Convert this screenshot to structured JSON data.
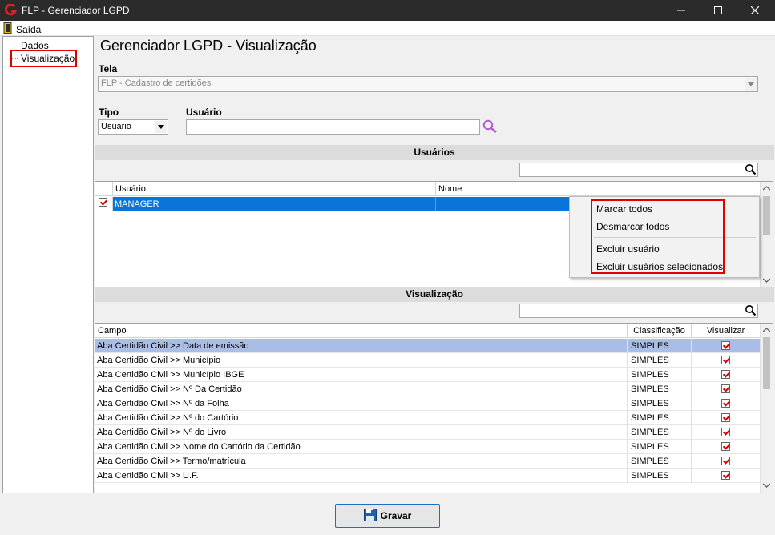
{
  "window": {
    "title": "FLP - Gerenciador LGPD"
  },
  "menu": {
    "exit_label": "Saída"
  },
  "tree": {
    "items": [
      {
        "label": "Dados"
      },
      {
        "label": "Visualização"
      }
    ]
  },
  "page": {
    "title": "Gerenciador LGPD - Visualização"
  },
  "form": {
    "tela_label": "Tela",
    "tela_value": "FLP - Cadastro de certidões",
    "tipo_label": "Tipo",
    "tipo_value": "Usuário",
    "usuario_label": "Usuário",
    "usuario_value": ""
  },
  "users_section": {
    "header": "Usuários",
    "search_value": "",
    "columns": [
      "Usuário",
      "Nome"
    ],
    "rows": [
      {
        "checked": true,
        "usuario": "MANAGER",
        "nome": ""
      }
    ]
  },
  "context_menu": {
    "items": [
      "Marcar todos",
      "Desmarcar todos",
      "Excluir usuário",
      "Excluir usuários selecionados"
    ]
  },
  "view_section": {
    "header": "Visualização",
    "search_value": "",
    "columns": [
      "Campo",
      "Classificação",
      "Visualizar"
    ],
    "rows": [
      {
        "campo": "Aba Certidão Civil >> Data de emissão",
        "classificacao": "SIMPLES",
        "visualizar": true
      },
      {
        "campo": "Aba Certidão Civil >> Município",
        "classificacao": "SIMPLES",
        "visualizar": true
      },
      {
        "campo": "Aba Certidão Civil >> Município IBGE",
        "classificacao": "SIMPLES",
        "visualizar": true
      },
      {
        "campo": "Aba Certidão Civil >> Nº Da Certidão",
        "classificacao": "SIMPLES",
        "visualizar": true
      },
      {
        "campo": "Aba Certidão Civil >> Nº da Folha",
        "classificacao": "SIMPLES",
        "visualizar": true
      },
      {
        "campo": "Aba Certidão Civil >> Nº do Cartório",
        "classificacao": "SIMPLES",
        "visualizar": true
      },
      {
        "campo": "Aba Certidão Civil >> Nº do Livro",
        "classificacao": "SIMPLES",
        "visualizar": true
      },
      {
        "campo": "Aba Certidão Civil >> Nome do Cartório da Certidão",
        "classificacao": "SIMPLES",
        "visualizar": true
      },
      {
        "campo": "Aba Certidão Civil >> Termo/matrícula",
        "classificacao": "SIMPLES",
        "visualizar": true
      },
      {
        "campo": "Aba Certidão Civil >> U.F.",
        "classificacao": "SIMPLES",
        "visualizar": true
      }
    ]
  },
  "actions": {
    "save_label": "Gravar"
  },
  "colors": {
    "selected_user_row": "#0a74da",
    "selected_view_row": "#a9bde6",
    "highlight_border": "#e00000",
    "search_icon_purple": "#b65bd6"
  }
}
